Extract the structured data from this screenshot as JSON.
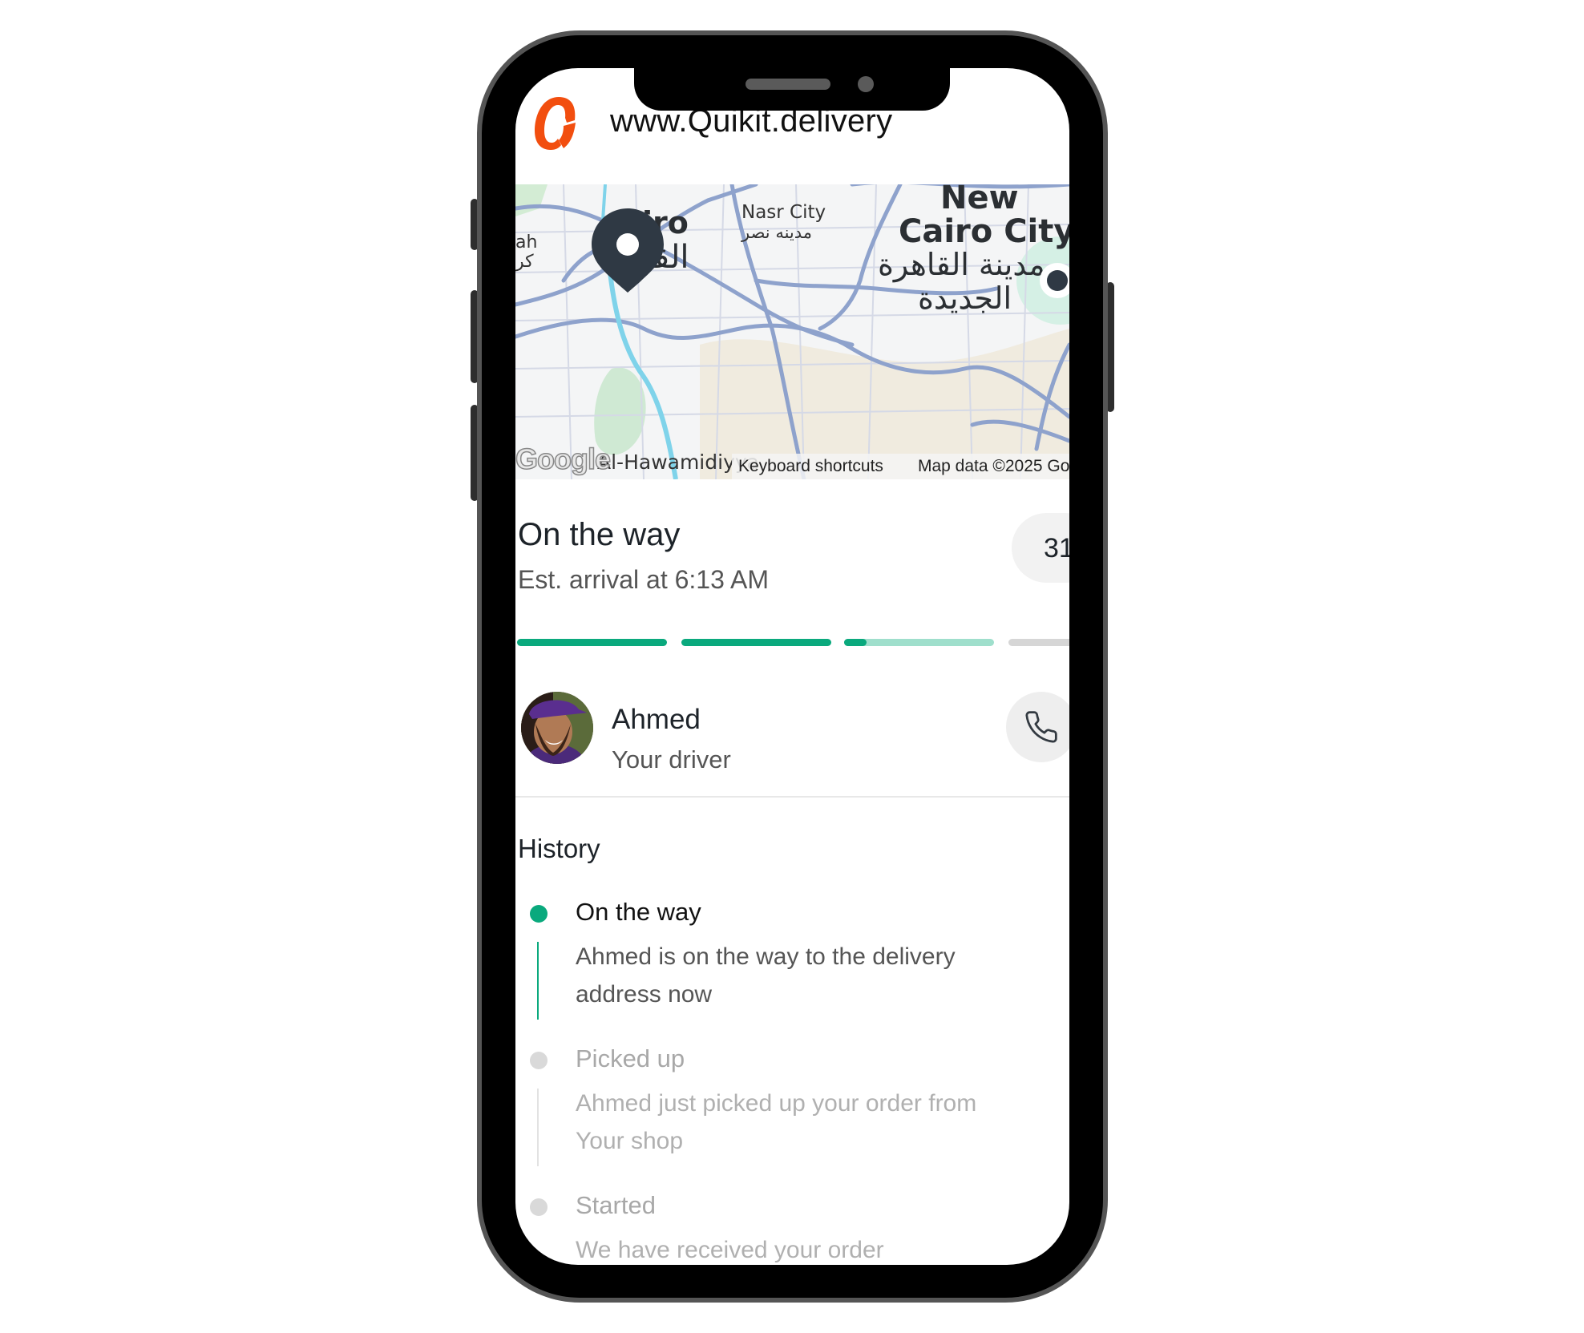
{
  "header": {
    "site_title": "www.Quikit.delivery",
    "logo_icon": "quikit-logo-icon",
    "brand_color": "#F24E0F"
  },
  "map": {
    "labels": {
      "cairo_en": "iro",
      "cairo_ar": "القاهـ",
      "giza_en": "ah",
      "giza_ar": "كر",
      "nasr_city_en": "Nasr City",
      "nasr_city_ar": "مدينه نصر",
      "new_cairo_line1": "New",
      "new_cairo_line2": "Cairo City",
      "new_cairo_ar1": "مدينة القاهرة",
      "new_cairo_ar2": "الجديدة",
      "hawamdiya": "Al-Hawamidiyya"
    },
    "google_logo": "Google",
    "keyboard_shortcuts": "Keyboard shortcuts",
    "map_data": "Map data ©2025 Go",
    "pickup_pin_icon": "map-pin-icon",
    "destination_marker_icon": "destination-dot-icon"
  },
  "status": {
    "title": "On the way",
    "eta_text": "Est. arrival at 6:13 AM",
    "eta_badge": "31",
    "progress_segments": [
      {
        "fill": 1.0,
        "state": "done"
      },
      {
        "fill": 1.0,
        "state": "done"
      },
      {
        "fill": 0.15,
        "state": "active"
      },
      {
        "fill": 0.0,
        "state": "pending"
      }
    ],
    "colors": {
      "done": "#0AA97D",
      "active_track": "#9FDFCC",
      "pending": "#D6D6D6"
    }
  },
  "driver": {
    "name": "Ahmed",
    "role": "Your driver",
    "call_icon": "phone-icon"
  },
  "history": {
    "title": "History",
    "items": [
      {
        "title": "On the way",
        "description": "Ahmed is on the way to the delivery address now",
        "active": true
      },
      {
        "title": "Picked up",
        "description": "Ahmed just picked up your order from Your shop",
        "active": false
      },
      {
        "title": "Started",
        "description": "We have received your order",
        "active": false
      }
    ]
  }
}
